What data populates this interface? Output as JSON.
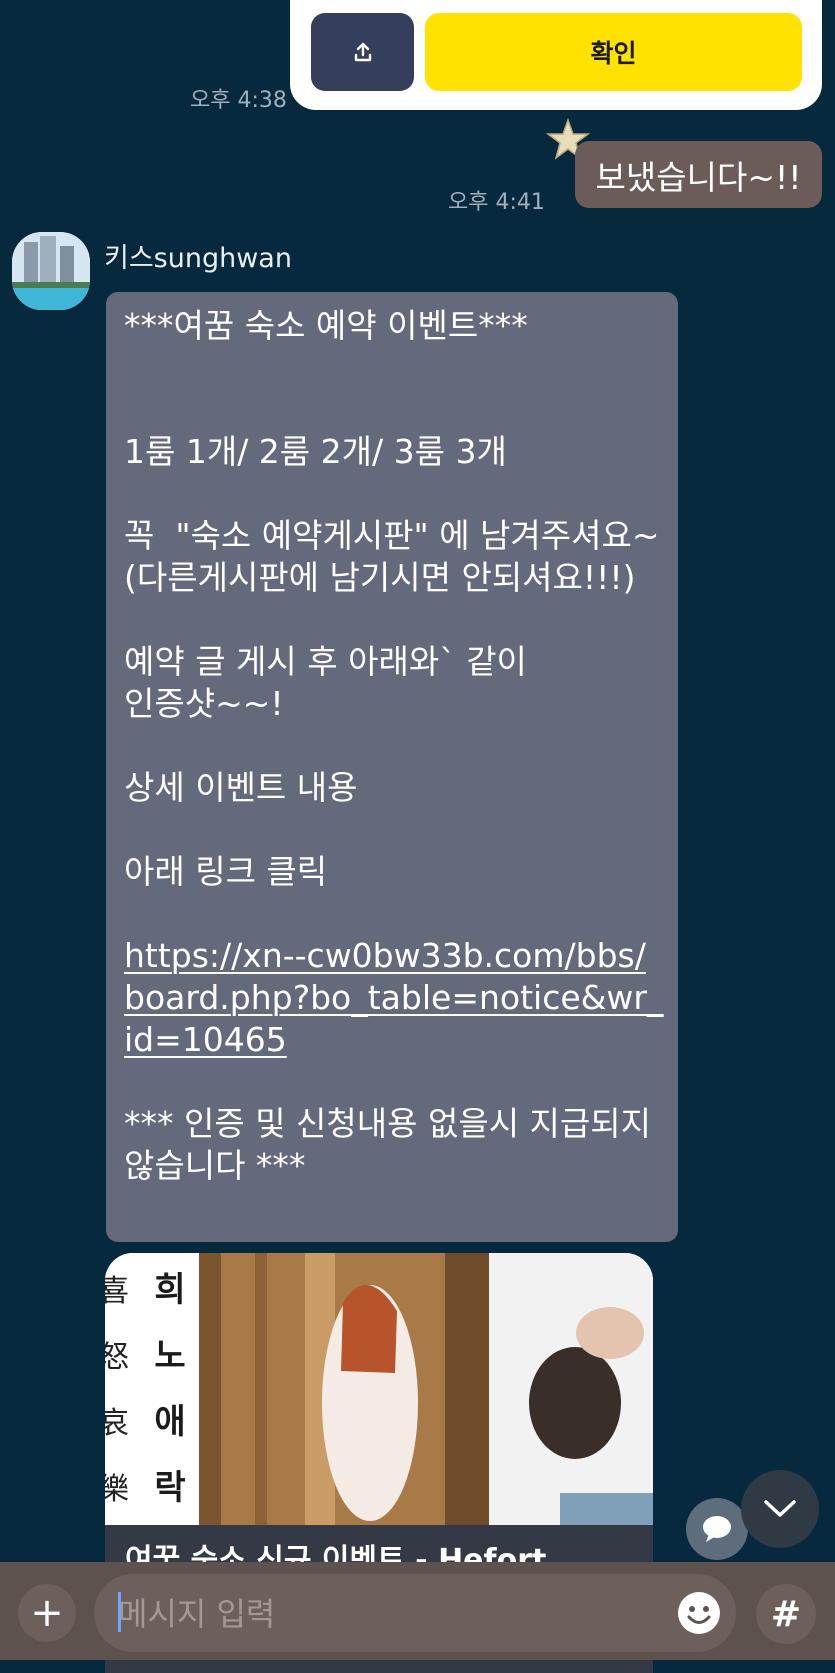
{
  "top_card": {
    "confirm_label": "확인",
    "time": "오후 4:38"
  },
  "sent_message": {
    "text": "보냈습니다~!!",
    "time": "오후 4:41"
  },
  "sender": {
    "name": "키스sunghwan"
  },
  "message": {
    "lines": [
      "***여꿈 숙소 예약 이벤트***",
      "",
      "",
      "1룸 1개/ 2룸 2개/ 3룸 3개",
      "",
      "꼭  \"숙소 예약게시판\" 에 남겨주셔요~",
      "(다른게시판에 남기시면 안되셔요!!!)",
      "",
      "예약 글 게시 후 아래와` 같이",
      "인증샷~~!",
      "",
      "상세 이벤트 내용",
      "",
      "아래 링크 클릭",
      ""
    ],
    "link": "https://xn--cw0bw33b.com/bbs/board.php?bo_table=notice&wr_id=10465",
    "footer": "*** 인증 및 신청내용 없을시 지급되지 않습니다 ***"
  },
  "link_preview": {
    "title": "여꿈 숙소 신규 이벤트 - Hefort",
    "side_text_right": [
      "희",
      "노",
      "애",
      "락"
    ],
    "side_text_left": [
      "喜",
      "怒",
      "哀",
      "樂"
    ]
  },
  "composer": {
    "placeholder": "메시지 입력"
  },
  "colors": {
    "background": "#07293d",
    "confirm": "#ffe200",
    "sent_bubble": "#6c5c58",
    "received_bubble": "#636a7b"
  },
  "icons": [
    "share-icon",
    "star-icon",
    "plus-icon",
    "emoji-icon",
    "hashtag-icon",
    "reply-icon",
    "chevron-down-icon"
  ]
}
